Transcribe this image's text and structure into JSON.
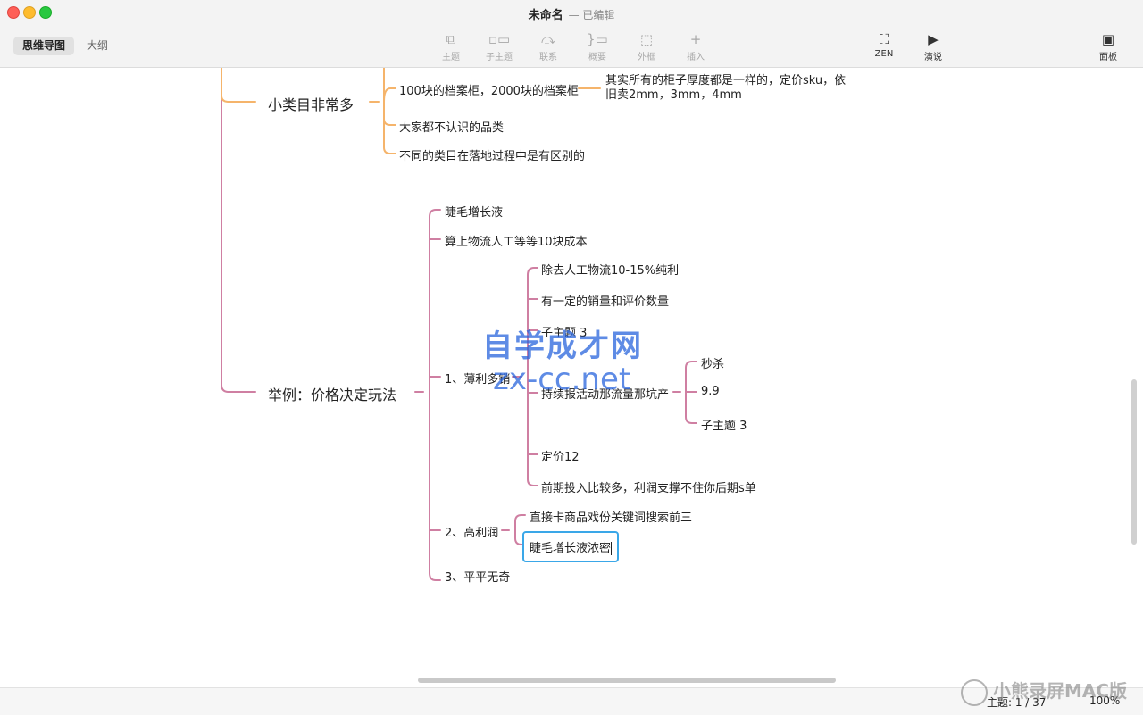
{
  "window": {
    "title": "未命名",
    "subtitle": "— 已编辑"
  },
  "view_tabs": {
    "mindmap": "思维导图",
    "outline": "大纲"
  },
  "toolbar": {
    "topic": "主题",
    "subtopic": "子主题",
    "relationship": "联系",
    "summary": "概要",
    "boundary": "外框",
    "insert": "插入",
    "zen": "ZEN",
    "present": "演说",
    "panel": "面板"
  },
  "mindmap": {
    "branch1": {
      "label": "小类目非常多",
      "children": [
        "100块的档案柜，2000块的档案柜",
        "大家都不认识的品类",
        "不同的类目在落地过程中是有区别的"
      ],
      "note": "其实所有的柜子厚度都是一样的，定价sku，依旧卖2mm，3mm，4mm"
    },
    "branch2": {
      "label": "举例：价格决定玩法",
      "children": [
        "睫毛增长液",
        "算上物流人工等等10块成本",
        "1、薄利多销",
        "2、高利润",
        "3、平平无奇"
      ],
      "thin_margin": [
        "除去人工物流10-15%纯利",
        "有一定的销量和评价数量",
        "子主题 3",
        "持续报活动那流量那坑产",
        "定价12",
        "前期投入比较多，利润支撑不住你后期s单"
      ],
      "activity": [
        "秒杀",
        "9.9",
        "子主题 3"
      ],
      "high_profit": [
        "直接卡商品戏份关键词搜索前三",
        "睫毛增长液浓密"
      ]
    }
  },
  "watermark": {
    "line1": "自学成才网",
    "line2": "zx-cc.net"
  },
  "status": {
    "topic_count": "主题: 1 / 37",
    "zoom": "100%"
  },
  "screen_watermark": "小熊录屏MAC版",
  "colors": {
    "branch1": "#f5b46b",
    "branch2": "#cf7fa2",
    "selection": "#3aa7e8"
  }
}
